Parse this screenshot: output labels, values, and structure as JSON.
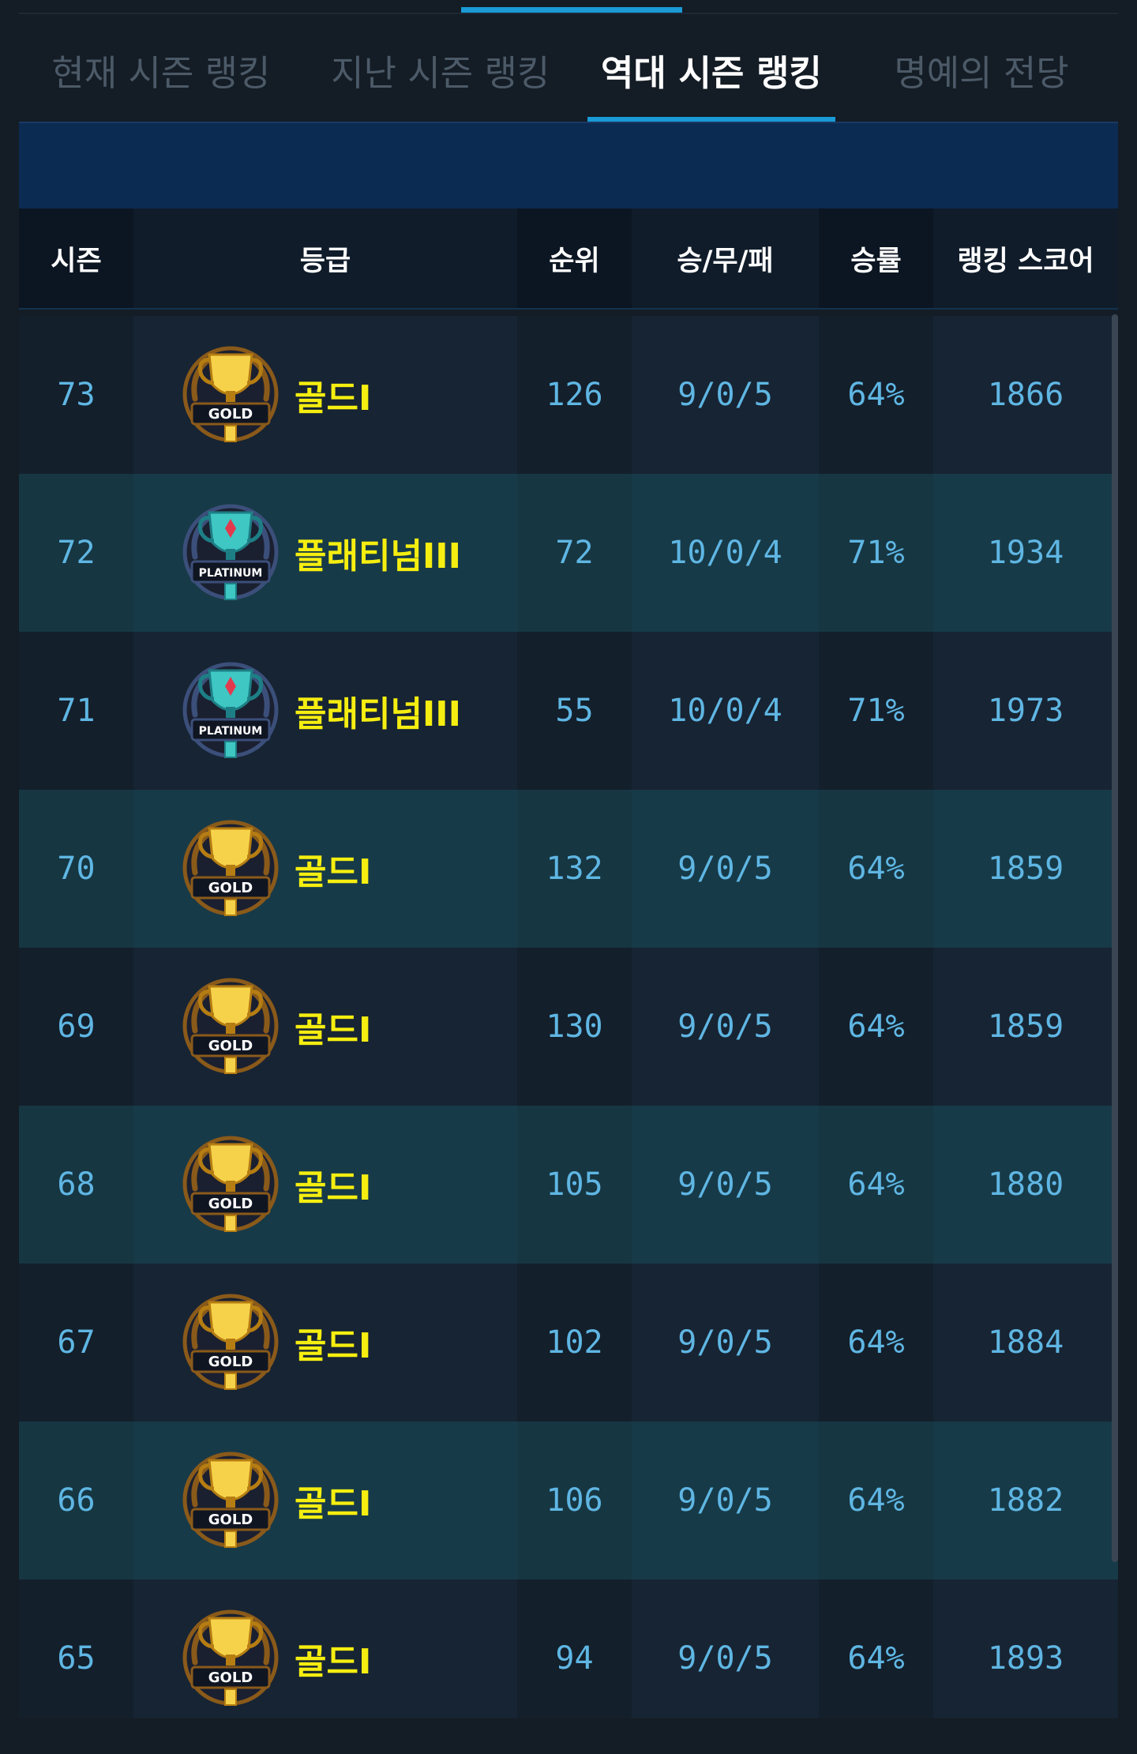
{
  "tabs": [
    {
      "label": "현재 시즌 랭킹",
      "active": false
    },
    {
      "label": "지난 시즌 랭킹",
      "active": false
    },
    {
      "label": "역대 시즌 랭킹",
      "active": true
    },
    {
      "label": "명예의 전당",
      "active": false
    }
  ],
  "table": {
    "headers": {
      "season": "시즌",
      "grade": "등급",
      "rank": "순위",
      "wdl": "승/무/패",
      "rate": "승률",
      "score": "랭킹 스코어"
    },
    "rows": [
      {
        "season": "73",
        "emblem": "gold-trophy-emblem",
        "emblem_text": "GOLD",
        "grade": "골드I",
        "rank": "126",
        "wdl": "9/0/5",
        "rate": "64%",
        "score": "1866"
      },
      {
        "season": "72",
        "emblem": "platinum-trophy-emblem",
        "emblem_text": "PLATINUM",
        "grade": "플래티넘III",
        "rank": "72",
        "wdl": "10/0/4",
        "rate": "71%",
        "score": "1934"
      },
      {
        "season": "71",
        "emblem": "platinum-trophy-emblem",
        "emblem_text": "PLATINUM",
        "grade": "플래티넘III",
        "rank": "55",
        "wdl": "10/0/4",
        "rate": "71%",
        "score": "1973"
      },
      {
        "season": "70",
        "emblem": "gold-trophy-emblem",
        "emblem_text": "GOLD",
        "grade": "골드I",
        "rank": "132",
        "wdl": "9/0/5",
        "rate": "64%",
        "score": "1859"
      },
      {
        "season": "69",
        "emblem": "gold-trophy-emblem",
        "emblem_text": "GOLD",
        "grade": "골드I",
        "rank": "130",
        "wdl": "9/0/5",
        "rate": "64%",
        "score": "1859"
      },
      {
        "season": "68",
        "emblem": "gold-trophy-emblem",
        "emblem_text": "GOLD",
        "grade": "골드I",
        "rank": "105",
        "wdl": "9/0/5",
        "rate": "64%",
        "score": "1880"
      },
      {
        "season": "67",
        "emblem": "gold-trophy-emblem",
        "emblem_text": "GOLD",
        "grade": "골드I",
        "rank": "102",
        "wdl": "9/0/5",
        "rate": "64%",
        "score": "1884"
      },
      {
        "season": "66",
        "emblem": "gold-trophy-emblem",
        "emblem_text": "GOLD",
        "grade": "골드I",
        "rank": "106",
        "wdl": "9/0/5",
        "rate": "64%",
        "score": "1882"
      },
      {
        "season": "65",
        "emblem": "gold-trophy-emblem",
        "emblem_text": "GOLD",
        "grade": "골드I",
        "rank": "94",
        "wdl": "9/0/5",
        "rate": "64%",
        "score": "1893"
      }
    ]
  },
  "colors": {
    "accent": "#1a9ad6",
    "tier_text": "#f5ee10",
    "value_text": "#5fb6e3"
  }
}
